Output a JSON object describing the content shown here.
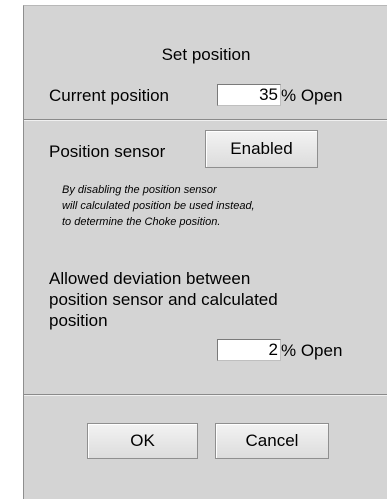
{
  "dialog": {
    "title": "Set position",
    "current_position": {
      "label": "Current position",
      "value": "35",
      "unit": "% Open"
    },
    "position_sensor": {
      "label": "Position sensor",
      "button_label": "Enabled"
    },
    "note_lines": [
      "By disabling the position sensor",
      "will calculated position be used instead,",
      "to determine the Choke position."
    ],
    "deviation": {
      "label_lines": [
        "Allowed deviation between",
        "position sensor and calculated",
        "position"
      ],
      "value": "2",
      "unit": "% Open"
    },
    "buttons": {
      "ok": "OK",
      "cancel": "Cancel"
    }
  }
}
